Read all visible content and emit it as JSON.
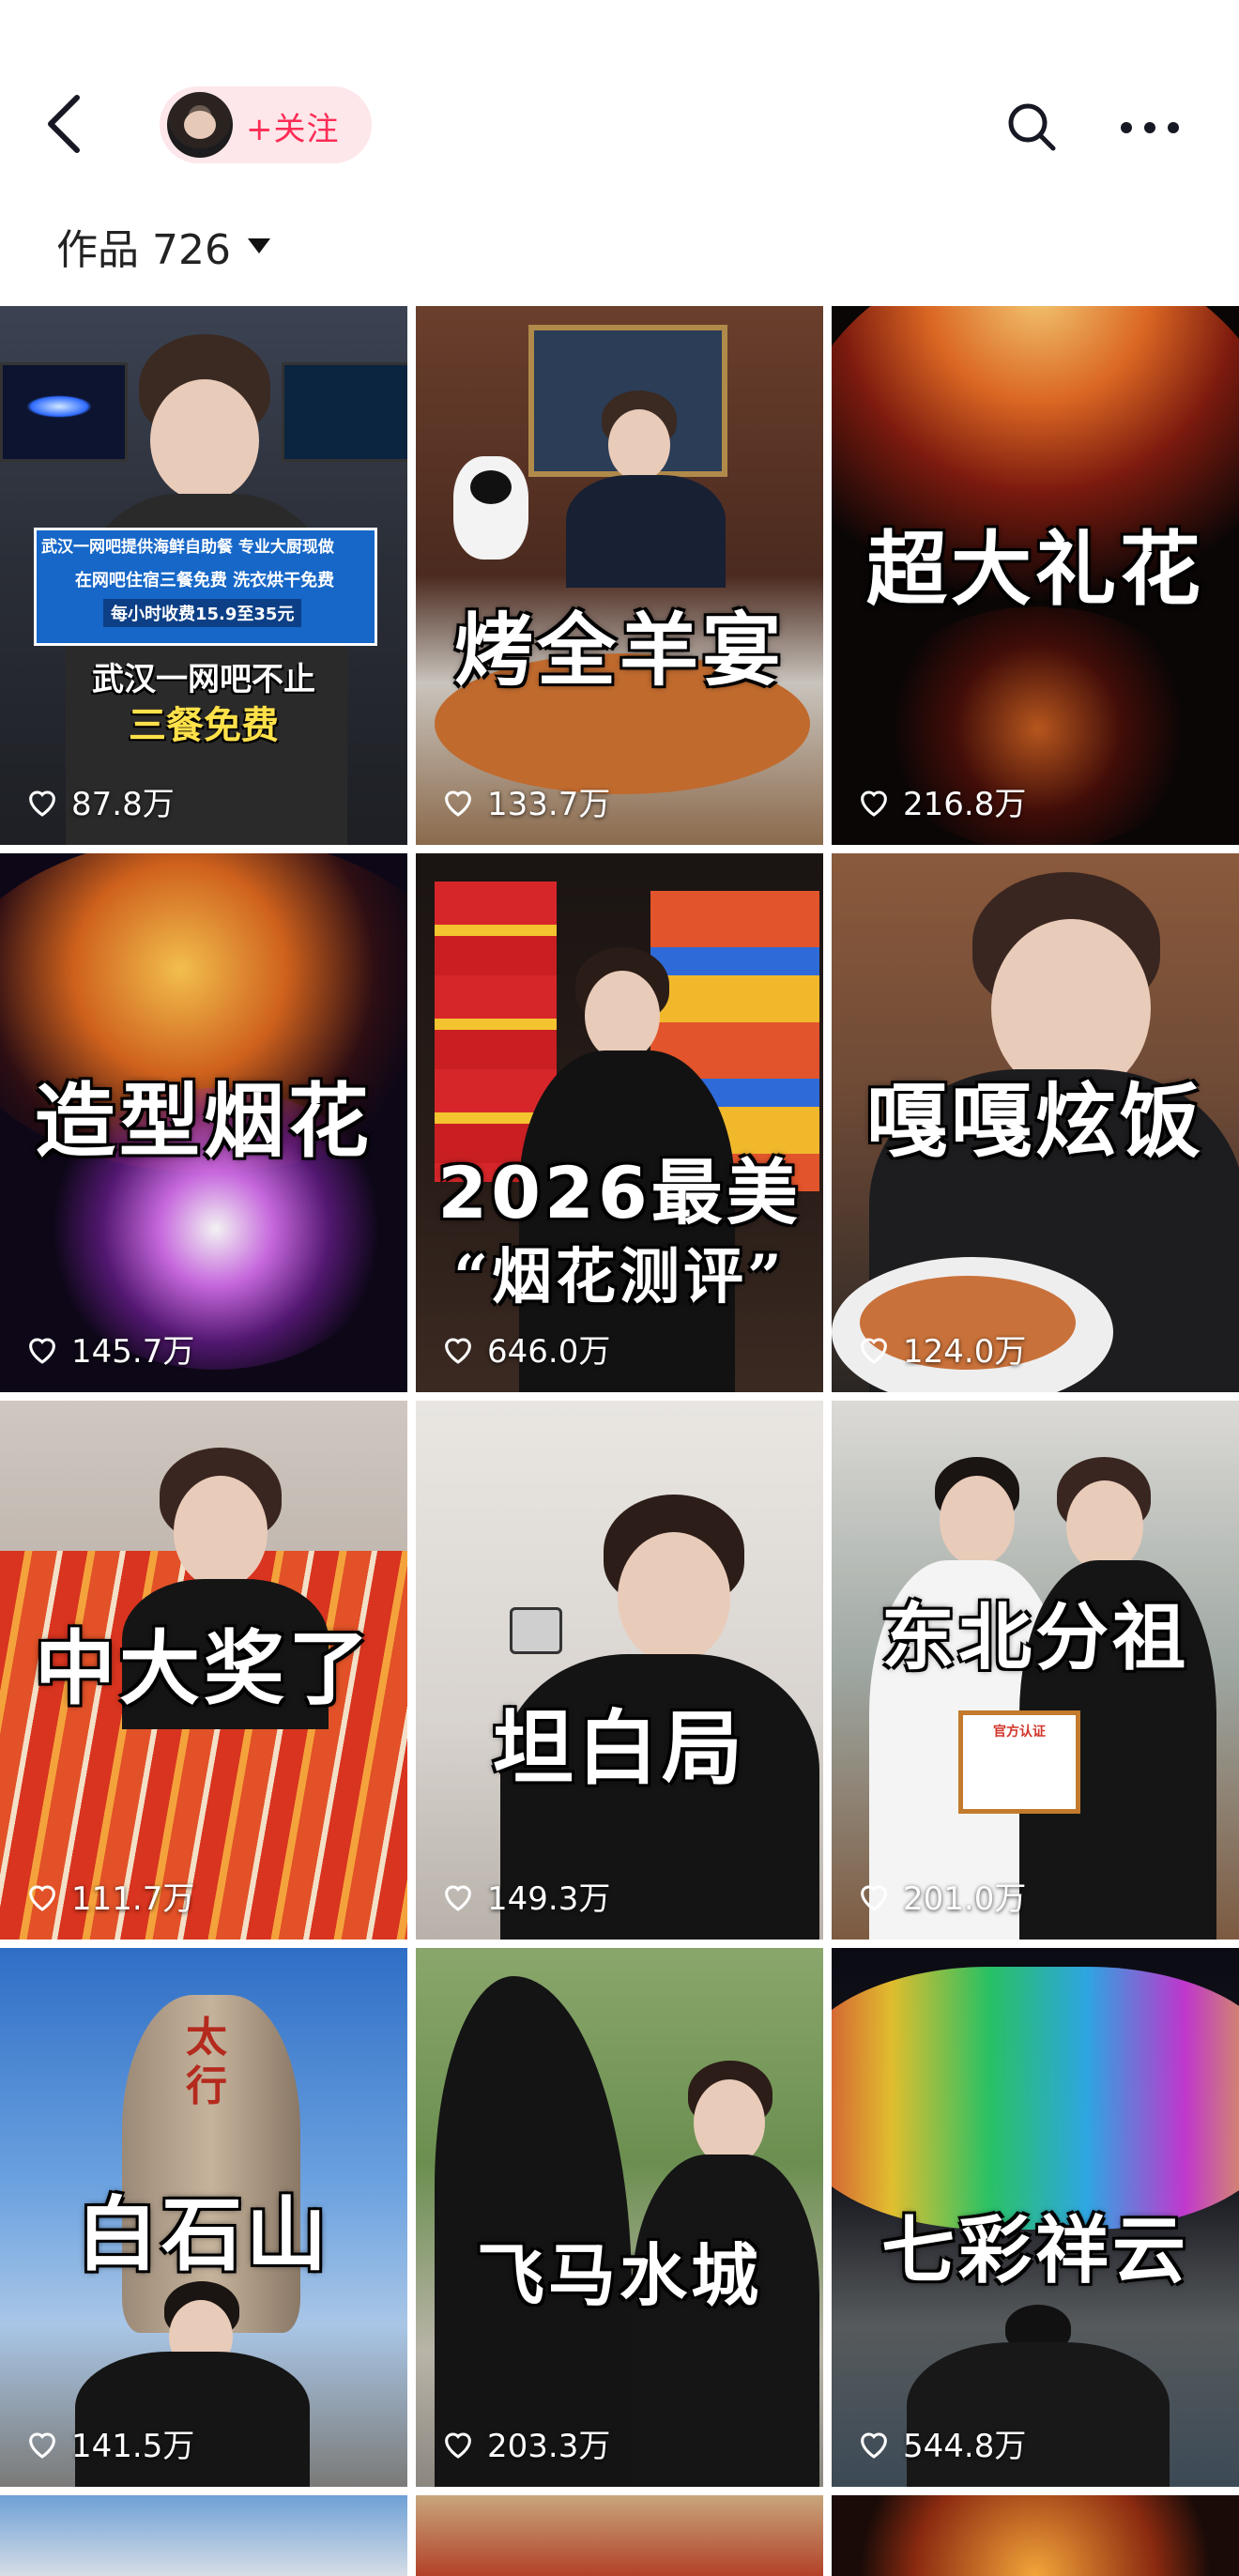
{
  "header": {
    "follow_label": "+关注",
    "works_label": "作品 726"
  },
  "icons": {
    "back": "chevron-left-icon",
    "search": "search-icon",
    "more": "more-horizontal-icon",
    "like": "heart-outline-icon",
    "dropdown": "caret-down-icon"
  },
  "colors": {
    "accent": "#fe2c55",
    "follow_bg": "#fde7ea"
  },
  "videos": [
    {
      "caption": "",
      "overlay_lines": [
        "武汉一网吧提供海鲜自助餐 专业大厨现做",
        "在网吧住宿三餐免费 洗衣烘干免费",
        "每小时收费15.9至35元",
        "武汉一网吧不止",
        "三餐免费"
      ],
      "likes": "87.8万"
    },
    {
      "caption": "烤全羊宴",
      "likes": "133.7万"
    },
    {
      "caption": "超大礼花",
      "likes": "216.8万"
    },
    {
      "caption": "造型烟花",
      "likes": "145.7万"
    },
    {
      "caption": "2026最美",
      "subcaption": "“烟花测评”",
      "likes": "646.0万"
    },
    {
      "caption": "嘎嘎炫饭",
      "likes": "124.0万"
    },
    {
      "caption": "中大奖了",
      "likes": "111.7万"
    },
    {
      "caption": "坦白局",
      "likes": "149.3万"
    },
    {
      "caption": "东北分祖",
      "badge": "官方认证",
      "likes": "201.0万"
    },
    {
      "caption": "白石山",
      "sign": "太行",
      "likes": "141.5万"
    },
    {
      "caption": "飞马水城",
      "likes": "203.3万"
    },
    {
      "caption": "七彩祥云",
      "likes": "544.8万"
    }
  ]
}
